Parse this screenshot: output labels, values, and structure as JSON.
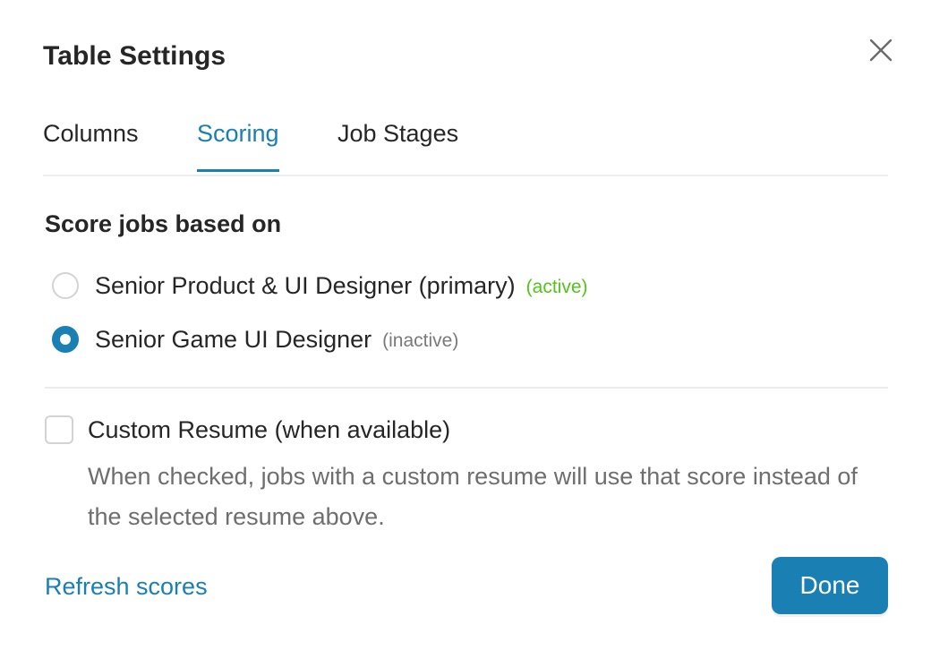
{
  "dialog": {
    "title": "Table Settings",
    "close_icon": "close-icon"
  },
  "tabs": [
    {
      "label": "Columns",
      "active": false
    },
    {
      "label": "Scoring",
      "active": true
    },
    {
      "label": "Job Stages",
      "active": false
    }
  ],
  "scoring": {
    "section_title": "Score jobs based on",
    "options": [
      {
        "label": "Senior Product & UI Designer (primary)",
        "status": "(active)",
        "selected": false
      },
      {
        "label": "Senior Game UI Designer",
        "status": "(inactive)",
        "selected": true
      }
    ],
    "custom_resume": {
      "label": "Custom Resume (when available)",
      "checked": false,
      "help": "When checked, jobs with a custom resume will use that score instead of the selected resume above."
    }
  },
  "footer": {
    "refresh_label": "Refresh scores",
    "done_label": "Done"
  },
  "colors": {
    "accent": "#1a7fb3",
    "active_status": "#52c41a",
    "inactive_status": "#7a7a7a"
  }
}
